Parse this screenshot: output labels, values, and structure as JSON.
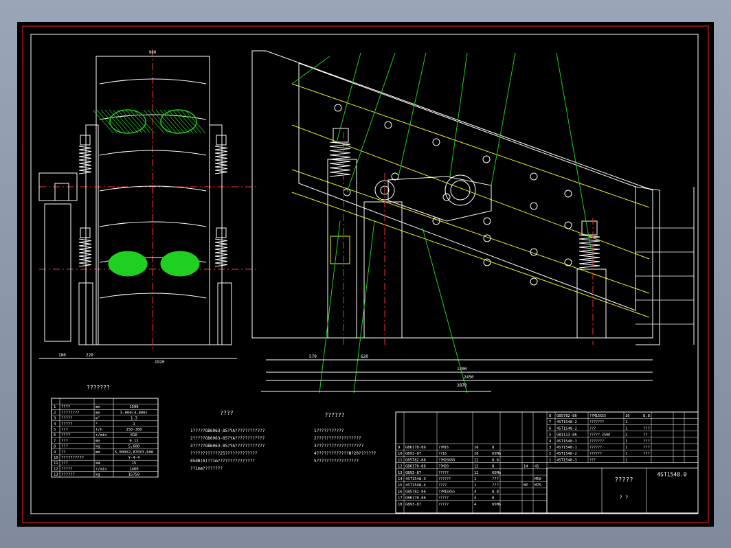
{
  "headings": {
    "params_table": "???????",
    "notes": "????",
    "notes2": "??????"
  },
  "params_rows": [
    [
      "1",
      "????",
      "mm",
      "1500"
    ],
    [
      "2",
      "????????",
      "mm",
      "5,000(4,800)"
    ],
    [
      "3",
      "?????",
      "m²",
      "1.3"
    ],
    [
      "4",
      "?????",
      "°",
      "1"
    ],
    [
      "5",
      "???",
      "t/h",
      "150-300"
    ],
    [
      "6",
      "????",
      "r/min",
      "810"
    ],
    [
      "7",
      "???",
      "mm",
      "9.12"
    ],
    [
      "8",
      "???",
      "kg",
      "5,600"
    ],
    [
      "9",
      "??",
      "mm",
      "5,000X2,870X3,600"
    ],
    [
      "10",
      "??????????",
      "",
      "Y-4-4"
    ],
    [
      "11",
      "???",
      "kW",
      "15"
    ],
    [
      "12",
      "?????",
      "r/min",
      "1460"
    ],
    [
      "13",
      "??????",
      "kg",
      "15750"
    ]
  ],
  "notes_lines": [
    "1?????GB6063-85?YA????????????",
    "2?????GB6063-85?YA????????????",
    "3?????GB6063-85?YA????????????",
    "  ????????????25?????????????",
    "  85dB(A)??1m???????????????",
    "  ??1mm????????"
  ],
  "notes2_lines": [
    "1???????????",
    "2??????????????????",
    "3???????????????????",
    "4?????????????N?20???????",
    "5?????????????????"
  ],
  "bom_left": [
    [
      "18",
      "GB93-87",
      "?????",
      "4",
      "65Mn",
      "",
      ""
    ],
    [
      "17",
      "GB6170-86",
      "?????",
      "4",
      "8",
      "",
      ""
    ],
    [
      "16",
      "GB5782-86",
      "??M16X55",
      "4",
      "8.8",
      "",
      ""
    ],
    [
      "15",
      "4ST1548-4",
      "????",
      "1",
      "???",
      "BP",
      "M75"
    ],
    [
      "14",
      "4ST1548-3",
      "??????",
      "1",
      "???",
      "",
      "M50"
    ],
    [
      "13",
      "GB93-87",
      "?????",
      "12",
      "65Mn",
      "",
      ""
    ],
    [
      "12",
      "GB6170-86",
      "??M20",
      "12",
      "8",
      "14",
      "41"
    ],
    [
      "11",
      "GB5782-86",
      "??M20X60",
      "12",
      "8.8",
      "",
      ""
    ],
    [
      "10",
      "GB93-87",
      "??16",
      "16",
      "65Mn",
      "",
      ""
    ],
    [
      "9",
      "GB6170-86",
      "??M16",
      "16",
      "8",
      "",
      ""
    ]
  ],
  "bom_right": [
    [
      "8",
      "GB5782-86",
      "??M16X55",
      "16",
      "8.8",
      "",
      ""
    ],
    [
      "7",
      "4ST1548-2",
      "???????",
      "1",
      "",
      "",
      ""
    ],
    [
      "6",
      "4ST1548-2",
      "???",
      "1",
      "???",
      "",
      ""
    ],
    [
      "5",
      "GB1113-86",
      "?????-2500",
      "2",
      "??",
      "",
      ""
    ],
    [
      "4",
      "4ST1548-1",
      "???????",
      "1",
      "???",
      "",
      ""
    ],
    [
      "3",
      "4ST1548-1",
      "??????",
      "1",
      "???",
      "",
      ""
    ],
    [
      "2",
      "4ST1548-2",
      "??????",
      "1",
      "???",
      "",
      ""
    ],
    [
      "1",
      "4ST1548-1",
      "???",
      "1",
      "",
      "",
      ""
    ]
  ],
  "title_block": {
    "drawing_no": "4ST1548.0",
    "name": "?????",
    "approve": "? ?"
  },
  "dimensions": {
    "top_width": "960",
    "left_bottom": [
      "100",
      "220",
      "1920"
    ],
    "right_bottom": [
      "570",
      "620",
      "1200",
      "2450"
    ],
    "overall": "3870"
  },
  "colors": {
    "frame": "#ff2020",
    "line": "#ffffff",
    "green": "#20d020",
    "yellow": "#f0f020",
    "red": "#ff3030"
  }
}
